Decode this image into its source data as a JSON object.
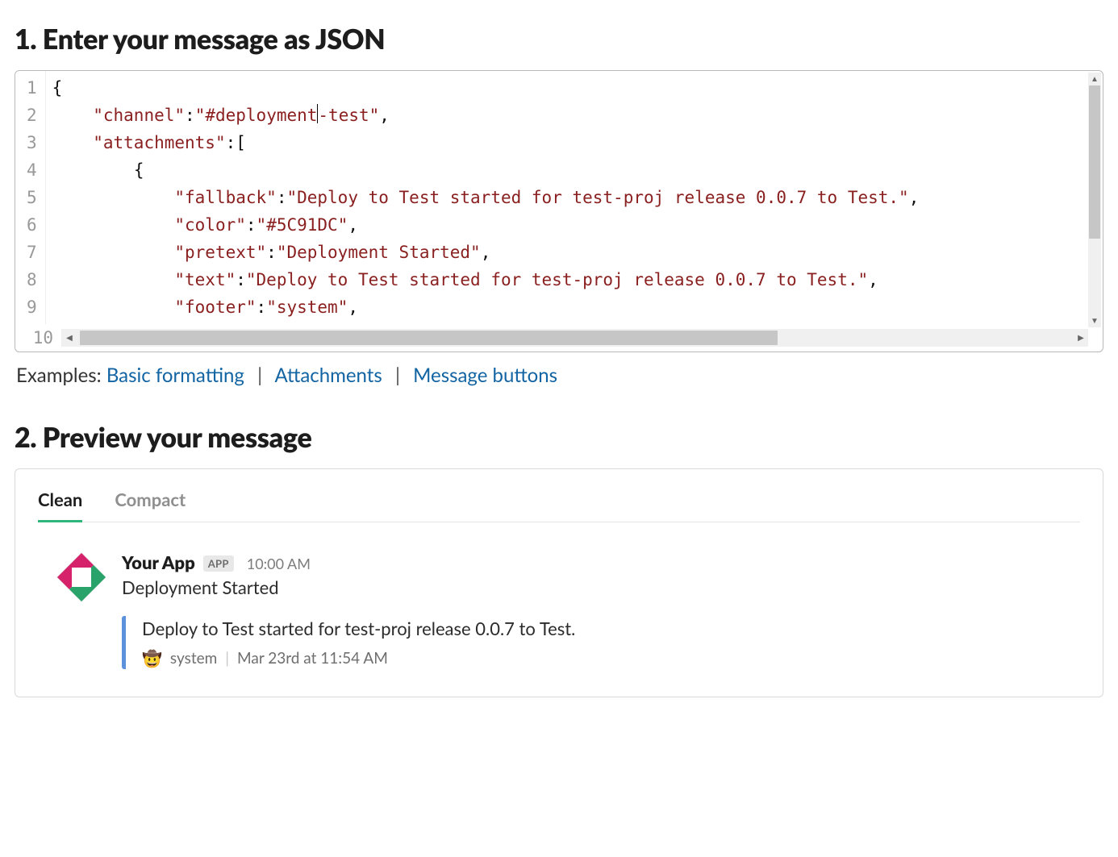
{
  "section1": {
    "heading": "1. Enter your message as JSON"
  },
  "editor": {
    "line_numbers": [
      "1",
      "2",
      "3",
      "4",
      "5",
      "6",
      "7",
      "8",
      "9",
      "10"
    ],
    "lines": [
      {
        "indent": 0,
        "tokens": [
          {
            "t": "punc",
            "v": "{"
          }
        ]
      },
      {
        "indent": 1,
        "tokens": [
          {
            "t": "key",
            "v": "\"channel\""
          },
          {
            "t": "punc",
            "v": ":"
          },
          {
            "t": "str",
            "v": "\"#deployment"
          },
          {
            "t": "caret",
            "v": ""
          },
          {
            "t": "str",
            "v": "-test\""
          },
          {
            "t": "punc",
            "v": ","
          }
        ]
      },
      {
        "indent": 1,
        "tokens": [
          {
            "t": "key",
            "v": "\"attachments\""
          },
          {
            "t": "punc",
            "v": ":["
          }
        ]
      },
      {
        "indent": 2,
        "tokens": [
          {
            "t": "punc",
            "v": "{"
          }
        ]
      },
      {
        "indent": 3,
        "tokens": [
          {
            "t": "key",
            "v": "\"fallback\""
          },
          {
            "t": "punc",
            "v": ":"
          },
          {
            "t": "str",
            "v": "\"Deploy to Test started for test-proj release 0.0.7 to Test.\""
          },
          {
            "t": "punc",
            "v": ","
          }
        ]
      },
      {
        "indent": 3,
        "tokens": [
          {
            "t": "key",
            "v": "\"color\""
          },
          {
            "t": "punc",
            "v": ":"
          },
          {
            "t": "str",
            "v": "\"#5C91DC\""
          },
          {
            "t": "punc",
            "v": ","
          }
        ]
      },
      {
        "indent": 3,
        "tokens": [
          {
            "t": "key",
            "v": "\"pretext\""
          },
          {
            "t": "punc",
            "v": ":"
          },
          {
            "t": "str",
            "v": "\"Deployment Started\""
          },
          {
            "t": "punc",
            "v": ","
          }
        ]
      },
      {
        "indent": 3,
        "tokens": [
          {
            "t": "key",
            "v": "\"text\""
          },
          {
            "t": "punc",
            "v": ":"
          },
          {
            "t": "str",
            "v": "\"Deploy to Test started for test-proj release 0.0.7 to Test.\""
          },
          {
            "t": "punc",
            "v": ","
          }
        ]
      },
      {
        "indent": 3,
        "tokens": [
          {
            "t": "key",
            "v": "\"footer\""
          },
          {
            "t": "punc",
            "v": ":"
          },
          {
            "t": "str",
            "v": "\"system\""
          },
          {
            "t": "punc",
            "v": ","
          }
        ]
      }
    ],
    "hscroll_gutter": "10"
  },
  "examples": {
    "label": "Examples:",
    "links": [
      "Basic formatting",
      "Attachments",
      "Message buttons"
    ],
    "sep": "|"
  },
  "section2": {
    "heading": "2. Preview your message"
  },
  "preview": {
    "tabs": [
      {
        "label": "Clean",
        "active": true
      },
      {
        "label": "Compact",
        "active": false
      }
    ],
    "sender": "Your App",
    "badge": "APP",
    "time": "10:00 AM",
    "pretext": "Deployment Started",
    "attachment": {
      "bar_color": "#5C91DC",
      "text": "Deploy to Test started for test-proj release 0.0.7 to Test.",
      "footer_icon": "🤠",
      "footer": "system",
      "footer_sep": "|",
      "footer_ts": "Mar 23rd at 11:54 AM"
    }
  }
}
